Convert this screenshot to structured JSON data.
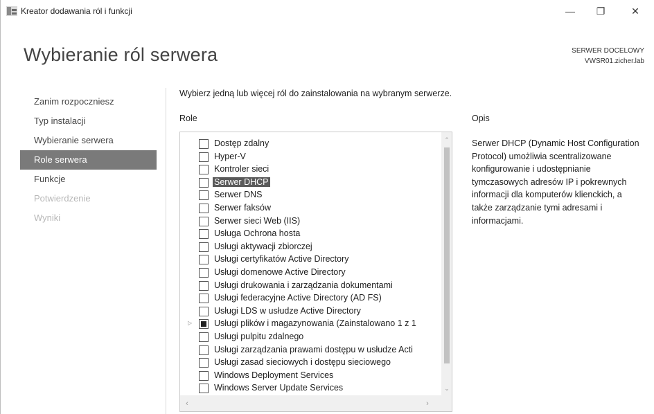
{
  "window": {
    "title": "Kreator dodawania ról i funkcji",
    "minimize_glyph": "—",
    "maximize_glyph": "❐",
    "close_glyph": "✕"
  },
  "header": {
    "page_title": "Wybieranie ról serwera",
    "destination_label": "SERWER DOCELOWY",
    "destination_server": "VWSR01.zicher.lab"
  },
  "nav": {
    "items": [
      {
        "label": "Zanim rozpoczniesz",
        "state": "normal"
      },
      {
        "label": "Typ instalacji",
        "state": "normal"
      },
      {
        "label": "Wybieranie serwera",
        "state": "normal"
      },
      {
        "label": "Role serwera",
        "state": "active"
      },
      {
        "label": "Funkcje",
        "state": "normal"
      },
      {
        "label": "Potwierdzenie",
        "state": "disabled"
      },
      {
        "label": "Wyniki",
        "state": "disabled"
      }
    ]
  },
  "content": {
    "instruction": "Wybierz jedną lub więcej ról do zainstalowania na wybranym serwerze.",
    "roles_heading": "Role",
    "description_heading": "Opis",
    "description_text": "Serwer DHCP (Dynamic Host Configuration Protocol) umożliwia scentralizowane konfigurowanie i udostępnianie tymczasowych adresów IP i pokrewnych informacji dla komputerów klienckich, a także zarządzanie tymi adresami i informacjami."
  },
  "roles": [
    {
      "label": "Dostęp zdalny",
      "checked": "none",
      "selected": false,
      "expandable": false
    },
    {
      "label": "Hyper-V",
      "checked": "none",
      "selected": false,
      "expandable": false
    },
    {
      "label": "Kontroler sieci",
      "checked": "none",
      "selected": false,
      "expandable": false
    },
    {
      "label": "Serwer DHCP",
      "checked": "none",
      "selected": true,
      "expandable": false
    },
    {
      "label": "Serwer DNS",
      "checked": "none",
      "selected": false,
      "expandable": false
    },
    {
      "label": "Serwer faksów",
      "checked": "none",
      "selected": false,
      "expandable": false
    },
    {
      "label": "Serwer sieci Web (IIS)",
      "checked": "none",
      "selected": false,
      "expandable": false
    },
    {
      "label": "Usługa Ochrona hosta",
      "checked": "none",
      "selected": false,
      "expandable": false
    },
    {
      "label": "Usługi aktywacji zbiorczej",
      "checked": "none",
      "selected": false,
      "expandable": false
    },
    {
      "label": "Usługi certyfikatów Active Directory",
      "checked": "none",
      "selected": false,
      "expandable": false
    },
    {
      "label": "Usługi domenowe Active Directory",
      "checked": "none",
      "selected": false,
      "expandable": false
    },
    {
      "label": "Usługi drukowania i zarządzania dokumentami",
      "checked": "none",
      "selected": false,
      "expandable": false
    },
    {
      "label": "Usługi federacyjne Active Directory (AD FS)",
      "checked": "none",
      "selected": false,
      "expandable": false
    },
    {
      "label": "Usługi LDS w usłudze Active Directory",
      "checked": "none",
      "selected": false,
      "expandable": false
    },
    {
      "label": "Usługi plików i magazynowania (Zainstalowano 1 z 1",
      "checked": "partial",
      "selected": false,
      "expandable": true
    },
    {
      "label": "Usługi pulpitu zdalnego",
      "checked": "none",
      "selected": false,
      "expandable": false
    },
    {
      "label": "Usługi zarządzania prawami dostępu w usłudze Acti",
      "checked": "none",
      "selected": false,
      "expandable": false
    },
    {
      "label": "Usługi zasad sieciowych i dostępu sieciowego",
      "checked": "none",
      "selected": false,
      "expandable": false
    },
    {
      "label": "Windows Deployment Services",
      "checked": "none",
      "selected": false,
      "expandable": false
    },
    {
      "label": "Windows Server Update Services",
      "checked": "none",
      "selected": false,
      "expandable": false
    }
  ],
  "icons": {
    "expander": "▷",
    "scroll_up": "⌃",
    "scroll_down": "⌄",
    "scroll_left": "‹",
    "scroll_right": "›"
  }
}
